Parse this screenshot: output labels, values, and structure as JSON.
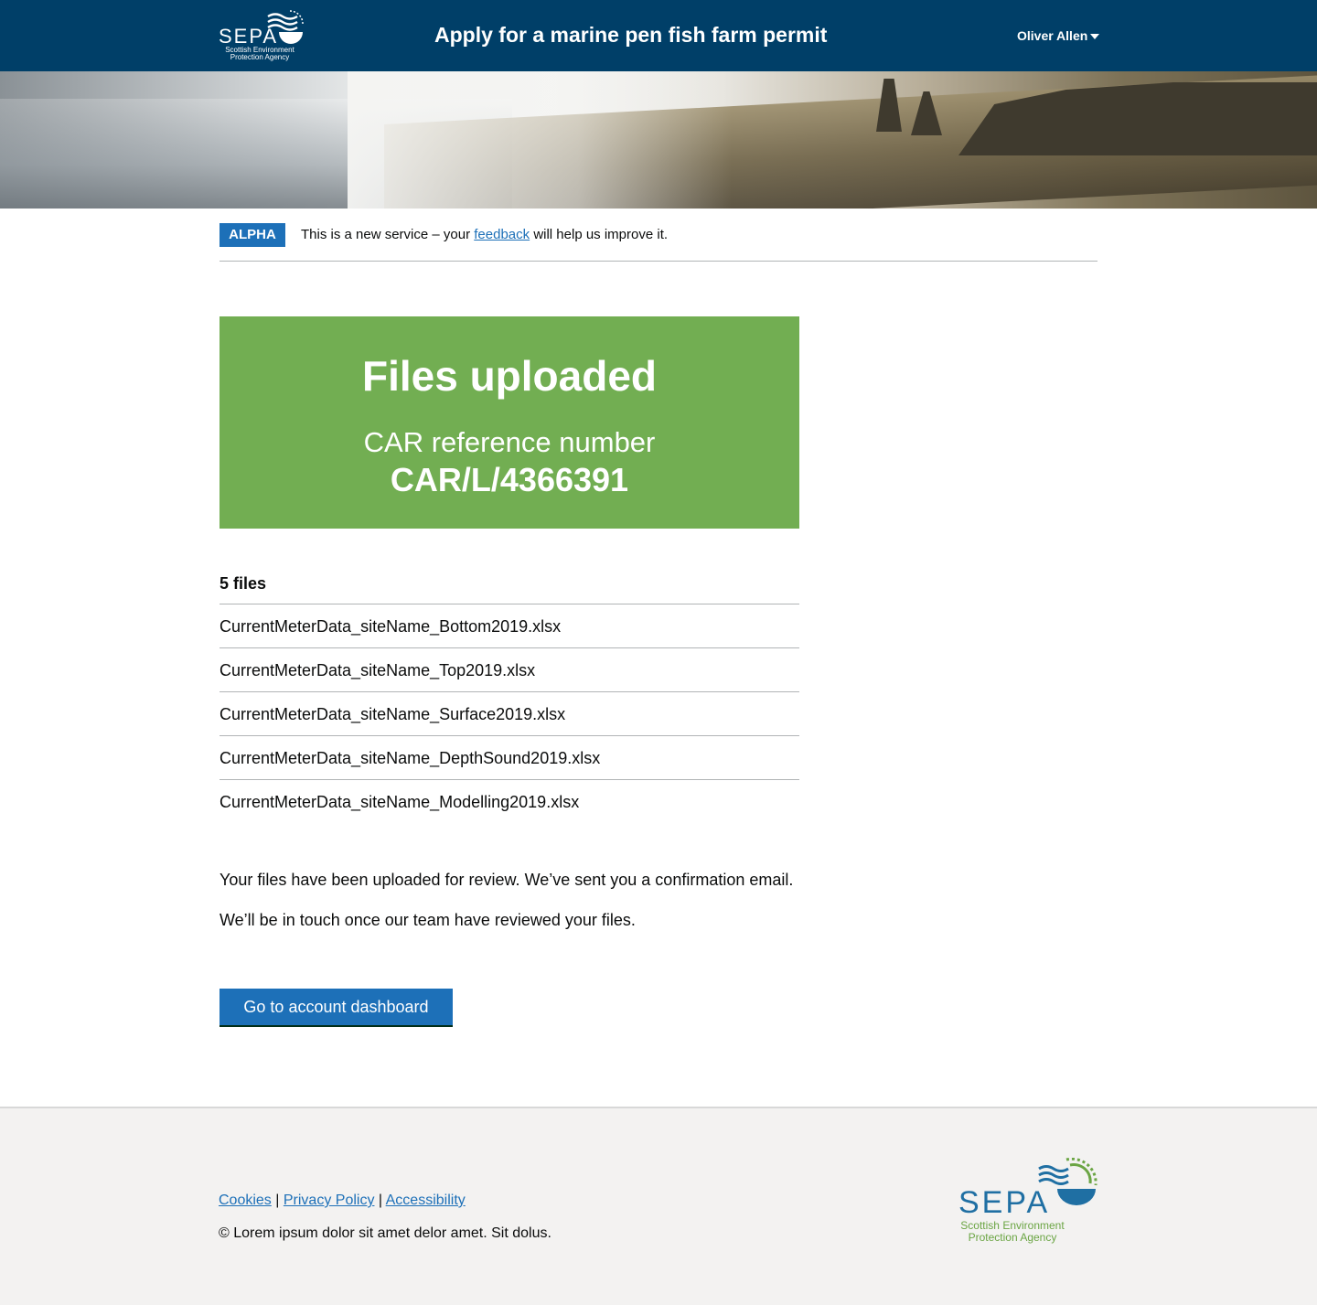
{
  "header": {
    "logo_text": "SEPA",
    "logo_subtext": "Scottish Environment Protection Agency",
    "service_title": "Apply for a marine pen fish farm permit",
    "user_name": "Oliver Allen"
  },
  "phase_banner": {
    "tag": "ALPHA",
    "text_before": "This is a new service – your",
    "link": "feedback",
    "text_after": "will help us improve it."
  },
  "panel": {
    "title": "Files uploaded",
    "reference_label": "CAR reference number",
    "reference_number": "CAR/L/4366391"
  },
  "files": {
    "heading": "5 files",
    "items": [
      "CurrentMeterData_siteName_Bottom2019.xlsx",
      "CurrentMeterData_siteName_Top2019.xlsx",
      "CurrentMeterData_siteName_Surface2019.xlsx",
      "CurrentMeterData_siteName_DepthSound2019.xlsx",
      "CurrentMeterData_siteName_Modelling2019.xlsx"
    ]
  },
  "messages": {
    "line1": "Your files have been uploaded for review. We’ve sent you a confirmation email.",
    "line2": "We’ll be in touch once our team have reviewed your files."
  },
  "actions": {
    "dashboard_button": "Go to account dashboard"
  },
  "footer": {
    "links": [
      "Cookies",
      "Privacy Policy",
      "Accessibility"
    ],
    "separator": "|",
    "copyright": "© Lorem ipsum dolor sit amet delor amet. Sit dolus.",
    "logo_text": "SEPA",
    "logo_subtext": "Scottish Environment Protection Agency"
  },
  "colors": {
    "header_bg": "#003f68",
    "panel_bg": "#72ae52",
    "link": "#1d70b8",
    "button_bg": "#1d70b8",
    "footer_bg": "#f3f2f1"
  },
  "icons": [
    "sepa-logo-icon",
    "chevron-down-icon",
    "sepa-footer-logo-icon"
  ]
}
